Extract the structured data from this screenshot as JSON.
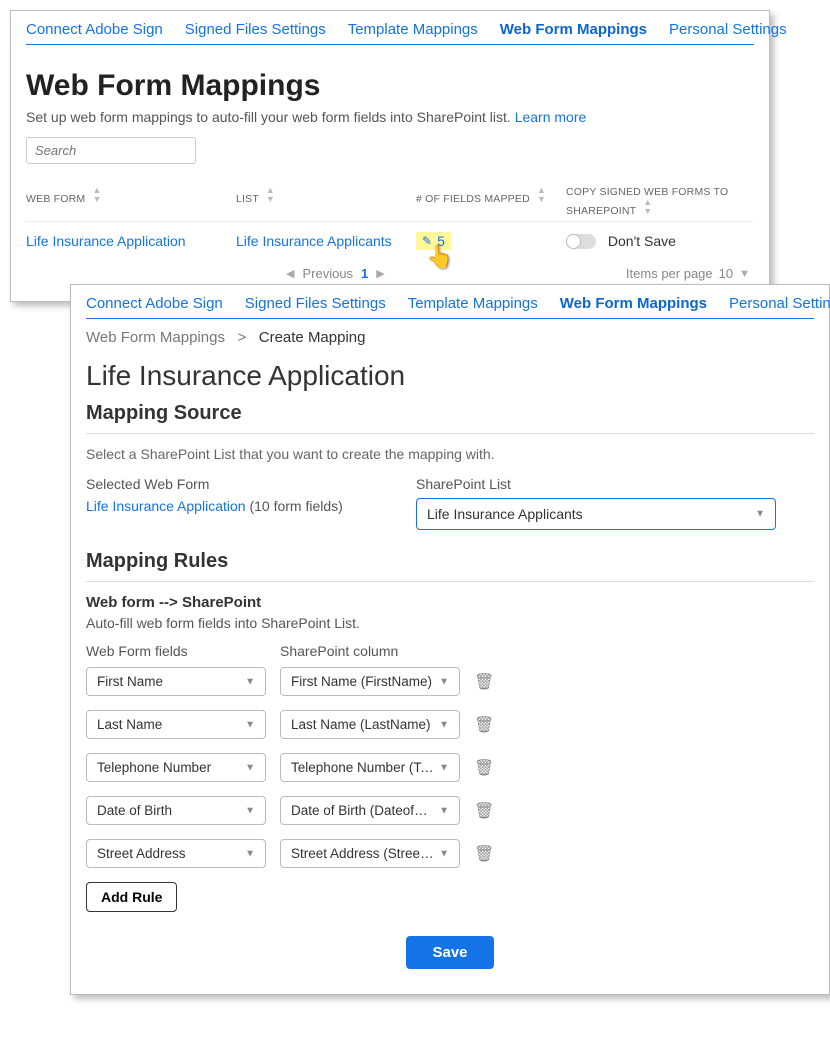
{
  "tabs": {
    "items": [
      {
        "label": "Connect Adobe Sign"
      },
      {
        "label": "Signed Files Settings"
      },
      {
        "label": "Template Mappings"
      },
      {
        "label": "Web Form Mappings",
        "active": true
      },
      {
        "label": "Personal Settings"
      }
    ]
  },
  "page": {
    "title": "Web Form Mappings",
    "subtitle": "Set up web form mappings to auto-fill your web form fields into SharePoint list.",
    "learn_more": "Learn more",
    "search_placeholder": "Search"
  },
  "grid": {
    "headers": {
      "webform": "WEB FORM",
      "list": "LIST",
      "fields": "# OF FIELDS MAPPED",
      "copy": "COPY SIGNED WEB FORMS TO SHAREPOINT"
    },
    "row": {
      "webform": "Life Insurance Application",
      "list": "Life Insurance Applicants",
      "fields_count": "5",
      "copy_label": "Don't Save"
    },
    "pager": {
      "prev": "Previous",
      "page": "1",
      "items_label": "Items per page",
      "items_value": "10"
    }
  },
  "breadcrumb": {
    "parent": "Web Form Mappings",
    "sep": ">",
    "current": "Create Mapping"
  },
  "detail": {
    "form_title": "Life Insurance Application",
    "mapping_source_h": "Mapping Source",
    "mapping_source_help": "Select a SharePoint List that you want to create the mapping with.",
    "selected_webform_label": "Selected Web Form",
    "selected_webform_value": "Life Insurance Application",
    "selected_webform_count": "(10 form fields)",
    "sp_list_label": "SharePoint List",
    "sp_list_value": "Life Insurance Applicants",
    "rules_h": "Mapping Rules",
    "direction": "Web form --> SharePoint",
    "rules_help": "Auto-fill web form fields into SharePoint List.",
    "col_webform": "Web Form fields",
    "col_spcol": "SharePoint column",
    "rules": [
      {
        "wf": "First Name",
        "sp": "First Name (FirstName)"
      },
      {
        "wf": "Last Name",
        "sp": "Last Name (LastName)"
      },
      {
        "wf": "Telephone Number",
        "sp": "Telephone Number (Tele…"
      },
      {
        "wf": "Date of Birth",
        "sp": "Date of Birth (DateofBirth)"
      },
      {
        "wf": "Street Address",
        "sp": "Street Address (StreetAd…"
      }
    ],
    "add_rule": "Add Rule",
    "save": "Save"
  }
}
